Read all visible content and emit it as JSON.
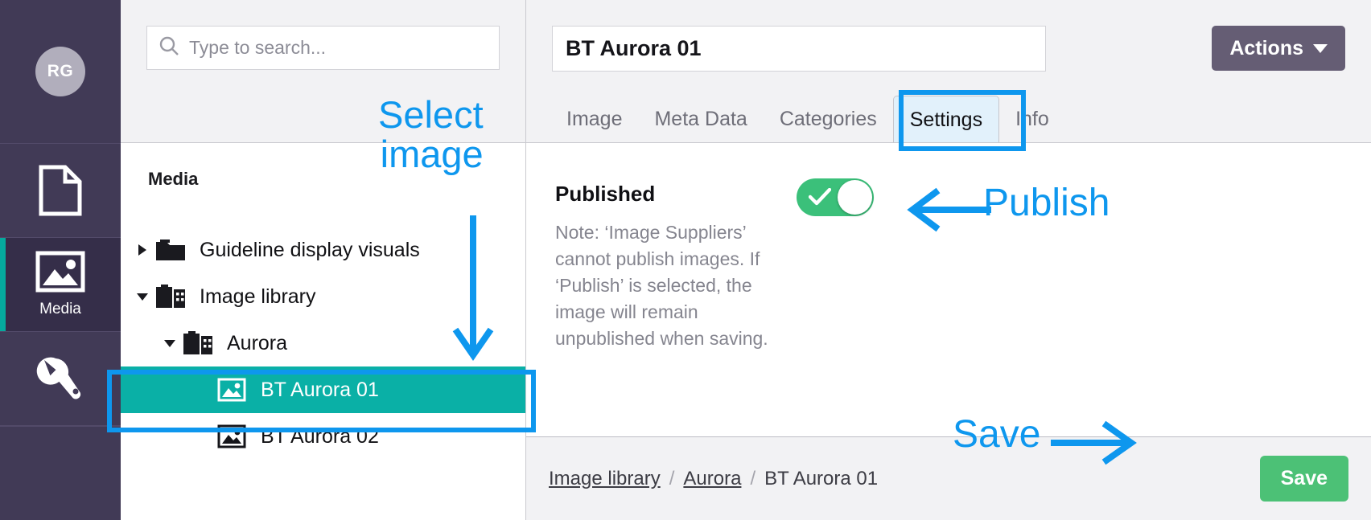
{
  "rail": {
    "avatar_initials": "RG",
    "items": [
      {
        "icon": "document-icon",
        "label": ""
      },
      {
        "icon": "image-icon",
        "label": "Media"
      },
      {
        "icon": "wrench-icon",
        "label": ""
      }
    ]
  },
  "search": {
    "placeholder": "Type to search...",
    "value": "",
    "icon": "search-icon"
  },
  "tree": {
    "title": "Media",
    "nodes": [
      {
        "label": "Guideline display visuals",
        "icon": "folder-icon",
        "caret": "collapsed",
        "depth": 0,
        "selected": false
      },
      {
        "label": "Image library",
        "icon": "media-folder-icon",
        "caret": "expanded",
        "depth": 0,
        "selected": false
      },
      {
        "label": "Aurora",
        "icon": "media-folder-icon",
        "caret": "expanded",
        "depth": 1,
        "selected": false
      },
      {
        "label": "BT Aurora 01",
        "icon": "image-icon",
        "caret": "none",
        "depth": 2,
        "selected": true
      },
      {
        "label": "BT Aurora 02",
        "icon": "image-icon",
        "caret": "none",
        "depth": 2,
        "selected": false
      }
    ]
  },
  "detail": {
    "title_value": "BT Aurora 01",
    "actions_label": "Actions",
    "tabs": [
      {
        "label": "Image",
        "active": false
      },
      {
        "label": "Meta Data",
        "active": false
      },
      {
        "label": "Categories",
        "active": false
      },
      {
        "label": "Settings",
        "active": true
      },
      {
        "label": "Info",
        "active": false
      }
    ],
    "settings": {
      "published_label": "Published",
      "published_note": "Note: ‘Image Suppliers’ cannot publish images. If ‘Publish’ is selected, the image will remain unpublished when saving.",
      "published_toggle_state": "on"
    },
    "breadcrumb": [
      {
        "label": "Image library",
        "link": true
      },
      {
        "label": "Aurora",
        "link": true
      },
      {
        "label": "BT Aurora 01",
        "link": false
      }
    ],
    "breadcrumb_separator": "/",
    "save_label": "Save"
  },
  "annotations": {
    "select_image": "Select\nimage",
    "publish": "Publish",
    "save": "Save",
    "color": "#0e97ee"
  },
  "colors": {
    "rail_bg": "#413a56",
    "rail_active_bg": "#352e49",
    "rail_accent": "#05aa9e",
    "selected_row": "#0ab0a6",
    "toggle_on": "#3bc07a",
    "save_button": "#4cc176",
    "actions_button": "#655d74",
    "annotation_blue": "#0e97ee",
    "tab_active_bg": "#e2f1fb"
  }
}
